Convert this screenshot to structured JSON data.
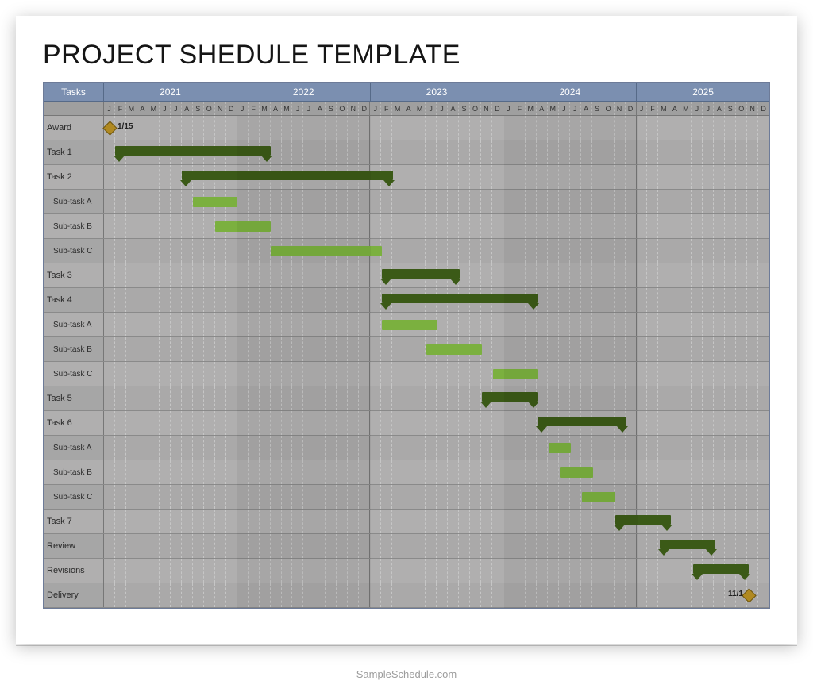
{
  "title": "PROJECT SHEDULE TEMPLATE",
  "footer": "SampleSchedule.com",
  "header": {
    "tasks_label": "Tasks"
  },
  "years": [
    "2021",
    "2022",
    "2023",
    "2024",
    "2025"
  ],
  "months": [
    "J",
    "F",
    "M",
    "A",
    "M",
    "J",
    "J",
    "A",
    "S",
    "O",
    "N",
    "D"
  ],
  "milestones": {
    "award_label": "1/15",
    "delivery_label": "11/1"
  },
  "rows": [
    {
      "label": "Award",
      "sub": false
    },
    {
      "label": "Task 1",
      "sub": false
    },
    {
      "label": "Task 2",
      "sub": false
    },
    {
      "label": "Sub-task A",
      "sub": true
    },
    {
      "label": "Sub-task B",
      "sub": true
    },
    {
      "label": "Sub-task C",
      "sub": true
    },
    {
      "label": "Task 3",
      "sub": false
    },
    {
      "label": "Task 4",
      "sub": false
    },
    {
      "label": "Sub-task A",
      "sub": true
    },
    {
      "label": "Sub-task B",
      "sub": true
    },
    {
      "label": "Sub-task C",
      "sub": true
    },
    {
      "label": "Task 5",
      "sub": false
    },
    {
      "label": "Task 6",
      "sub": false
    },
    {
      "label": "Sub-task A",
      "sub": true
    },
    {
      "label": "Sub-task B",
      "sub": true
    },
    {
      "label": "Sub-task C",
      "sub": true
    },
    {
      "label": "Task 7",
      "sub": false
    },
    {
      "label": "Review",
      "sub": false
    },
    {
      "label": "Revisions",
      "sub": false
    },
    {
      "label": "Delivery",
      "sub": false
    }
  ],
  "chart_data": {
    "type": "gantt",
    "title": "PROJECT SHEDULE TEMPLATE",
    "x_axis": {
      "unit": "month",
      "start": "2021-01",
      "end": "2025-12"
    },
    "tasks": [
      {
        "name": "Award",
        "type": "milestone",
        "date": "2021-01-15",
        "label": "1/15"
      },
      {
        "name": "Task 1",
        "type": "summary",
        "start": "2021-02",
        "end": "2022-03"
      },
      {
        "name": "Task 2",
        "type": "summary",
        "start": "2021-08",
        "end": "2023-02"
      },
      {
        "name": "Sub-task A",
        "parent": "Task 2",
        "type": "bar",
        "start": "2021-09",
        "end": "2021-12"
      },
      {
        "name": "Sub-task B",
        "parent": "Task 2",
        "type": "bar",
        "start": "2021-11",
        "end": "2022-03"
      },
      {
        "name": "Sub-task C",
        "parent": "Task 2",
        "type": "bar",
        "start": "2022-04",
        "end": "2023-01"
      },
      {
        "name": "Task 3",
        "type": "summary",
        "start": "2023-02",
        "end": "2023-08"
      },
      {
        "name": "Task 4",
        "type": "summary",
        "start": "2023-02",
        "end": "2024-03"
      },
      {
        "name": "Sub-task A",
        "parent": "Task 4",
        "type": "bar",
        "start": "2023-02",
        "end": "2023-06"
      },
      {
        "name": "Sub-task B",
        "parent": "Task 4",
        "type": "bar",
        "start": "2023-06",
        "end": "2023-10"
      },
      {
        "name": "Sub-task C",
        "parent": "Task 4",
        "type": "bar",
        "start": "2023-12",
        "end": "2024-03"
      },
      {
        "name": "Task 5",
        "type": "summary",
        "start": "2023-11",
        "end": "2024-03"
      },
      {
        "name": "Task 6",
        "type": "summary",
        "start": "2024-04",
        "end": "2024-11"
      },
      {
        "name": "Sub-task A",
        "parent": "Task 6",
        "type": "bar",
        "start": "2024-05",
        "end": "2024-06"
      },
      {
        "name": "Sub-task B",
        "parent": "Task 6",
        "type": "bar",
        "start": "2024-06",
        "end": "2024-08"
      },
      {
        "name": "Sub-task C",
        "parent": "Task 6",
        "type": "bar",
        "start": "2024-08",
        "end": "2024-10"
      },
      {
        "name": "Task 7",
        "type": "summary",
        "start": "2024-11",
        "end": "2025-03"
      },
      {
        "name": "Review",
        "type": "summary",
        "start": "2025-03",
        "end": "2025-07"
      },
      {
        "name": "Revisions",
        "type": "summary",
        "start": "2025-06",
        "end": "2025-10"
      },
      {
        "name": "Delivery",
        "type": "milestone",
        "date": "2025-11-01",
        "label": "11/1"
      }
    ]
  }
}
